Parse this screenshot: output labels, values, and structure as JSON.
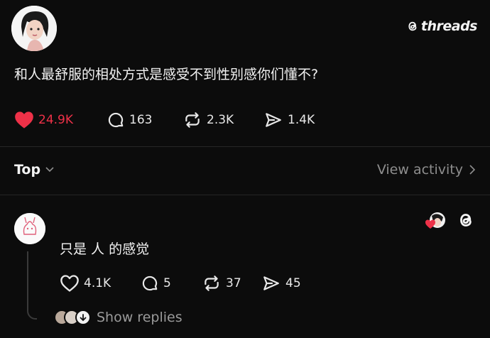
{
  "header": {
    "brand": "threads",
    "brand_icon": "threads-logo-icon"
  },
  "post": {
    "text": "和人最舒服的相处方式是感受不到性别感你们懂不?",
    "likes": "24.9K",
    "replies": "163",
    "reposts": "2.3K",
    "shares": "1.4K",
    "liked_color": "#ee3148"
  },
  "sort": {
    "label": "Top",
    "activity_label": "View activity"
  },
  "reply": {
    "text": "只是 人 的感觉",
    "likes": "4.1K",
    "replies": "5",
    "reposts": "37",
    "shares": "45",
    "show_replies_label": "Show replies"
  }
}
